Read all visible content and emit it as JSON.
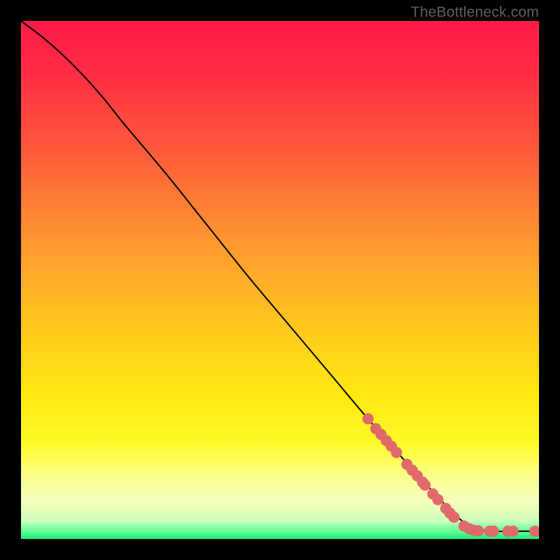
{
  "attribution": "TheBottleneck.com",
  "gradient_stops": [
    {
      "offset": 0,
      "color": "#ff1a48"
    },
    {
      "offset": 0.1,
      "color": "#ff2d44"
    },
    {
      "offset": 0.25,
      "color": "#ff5a3a"
    },
    {
      "offset": 0.42,
      "color": "#ff9530"
    },
    {
      "offset": 0.58,
      "color": "#ffc51f"
    },
    {
      "offset": 0.72,
      "color": "#ffe80f"
    },
    {
      "offset": 0.85,
      "color": "#fdff30"
    },
    {
      "offset": 0.93,
      "color": "#f1ffa0"
    },
    {
      "offset": 0.965,
      "color": "#c8ffb8"
    },
    {
      "offset": 0.985,
      "color": "#66ff99"
    },
    {
      "offset": 1.0,
      "color": "#1be879"
    }
  ],
  "pale_band": {
    "top_pct": 81,
    "bottom_pct": 97.2
  },
  "chart_data": {
    "type": "line",
    "title": "",
    "xlabel": "",
    "ylabel": "",
    "xlim": [
      0,
      100
    ],
    "ylim": [
      0,
      100
    ],
    "series": [
      {
        "name": "curve",
        "x": [
          0,
          4,
          8,
          12,
          16,
          20,
          28,
          36,
          44,
          52,
          60,
          68,
          76,
          84,
          88,
          92,
          96,
          100
        ],
        "y": [
          100,
          97,
          93.5,
          89.5,
          85,
          80,
          70.5,
          60.5,
          50.5,
          41,
          31.5,
          22,
          13,
          4.5,
          2,
          1.5,
          1.5,
          1.5
        ]
      }
    ],
    "markers": {
      "name": "dots",
      "color": "#e0696b",
      "r": 8,
      "x": [
        67,
        68.5,
        69.5,
        70.5,
        71.5,
        72.5,
        74.5,
        75.5,
        76.5,
        77.5,
        78,
        79.5,
        80.5,
        82,
        82.8,
        83.6,
        85.5,
        86.5,
        87.3,
        88.3,
        90.5,
        91.2,
        94,
        95,
        99.2
      ],
      "y": [
        23.2,
        21.3,
        20.2,
        19.0,
        17.9,
        16.7,
        14.4,
        13.3,
        12.2,
        11.0,
        10.4,
        8.7,
        7.6,
        5.9,
        5.0,
        4.2,
        2.5,
        2.0,
        1.7,
        1.6,
        1.5,
        1.5,
        1.5,
        1.5,
        1.5
      ]
    }
  }
}
